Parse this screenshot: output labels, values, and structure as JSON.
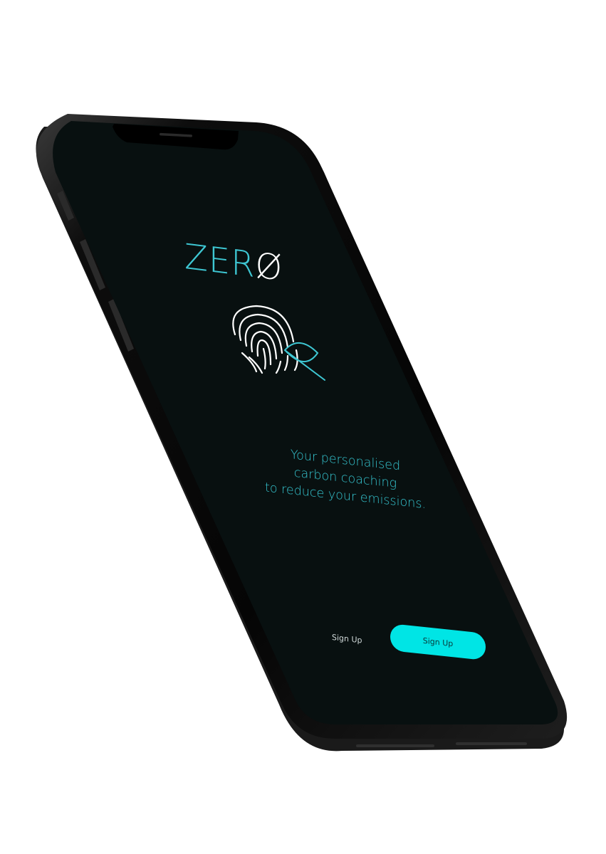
{
  "app": {
    "logo_main": "ZER",
    "logo_mark": "Ø"
  },
  "tagline": {
    "line1": "Your personalised",
    "line2": "carbon coaching",
    "line3": "to reduce your emissions."
  },
  "actions": {
    "secondary_label": "Sign Up",
    "primary_label": "Sign Up"
  },
  "icons": {
    "hero": "fingerprint-leaf-icon"
  },
  "colors": {
    "screen_background": "#081010",
    "accent": "#3ec7d3",
    "primary_button": "#00e5e5",
    "phone_frame": "#111111"
  }
}
